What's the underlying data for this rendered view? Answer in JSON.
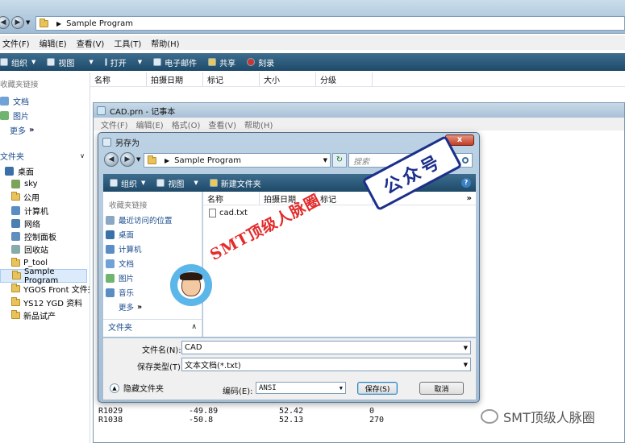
{
  "explorer": {
    "breadcrumb": "Sample Program",
    "menu": [
      "文件(F)",
      "编辑(E)",
      "查看(V)",
      "工具(T)",
      "帮助(H)"
    ],
    "toolbar": [
      "组织",
      "视图",
      "打开",
      "电子邮件",
      "共享",
      "刻录"
    ],
    "columns": [
      "名称",
      "拍摄日期",
      "标记",
      "大小",
      "分级"
    ],
    "favorites_header": "收藏夹链接",
    "favorites": [
      "文档",
      "图片",
      "更多"
    ],
    "folders_header": "文件夹",
    "tree": [
      "桌面",
      "sky",
      "公用",
      "计算机",
      "网络",
      "控制面板",
      "回收站",
      "P_tool",
      "Sample Program",
      "YGOS Front 文件夹",
      "YS12 YGD 资料",
      "新品试产"
    ]
  },
  "notepad": {
    "title": "CAD.prn - 记事本",
    "menu": [
      "文件(F)",
      "编辑(E)",
      "格式(O)",
      "查看(V)",
      "帮助(H)"
    ],
    "rows": [
      [
        "R1029",
        "-49.89",
        "52.42",
        "0"
      ],
      [
        "R1038",
        "-50.8",
        "52.13",
        "270"
      ]
    ]
  },
  "dialog": {
    "title": "另存为",
    "breadcrumb": "Sample Program",
    "search_placeholder": "搜索",
    "toolbar": [
      "组织",
      "视图",
      "新建文件夹"
    ],
    "favorites_header": "收藏夹链接",
    "favorites": [
      "最近访问的位置",
      "桌面",
      "计算机",
      "文档",
      "图片",
      "音乐",
      "更多"
    ],
    "folders_label": "文件夹",
    "columns": [
      "名称",
      "拍摄日期",
      "标记"
    ],
    "files": [
      "cad.txt"
    ],
    "filename_label": "文件名(N):",
    "filename_value": "CAD",
    "filetype_label": "保存类型(T):",
    "filetype_value": "文本文档(*.txt)",
    "hide_folders": "隐藏文件夹",
    "encoding_label": "编码(E):",
    "encoding_value": "ANSI",
    "save": "保存(S)",
    "cancel": "取消"
  },
  "watermark": {
    "text": "SMT顶级人脉圈",
    "seal": "公众号",
    "footer": "SMT顶级人脉圈"
  }
}
